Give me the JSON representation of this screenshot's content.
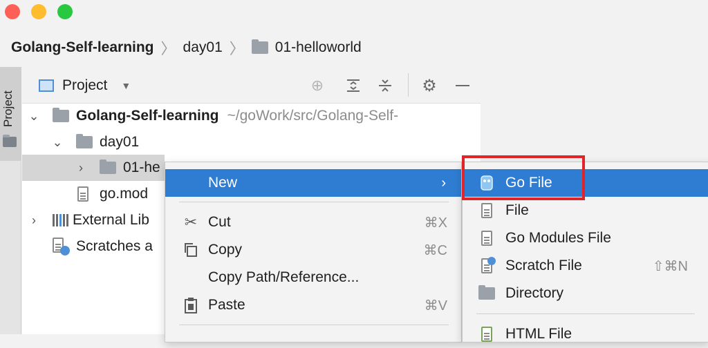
{
  "breadcrumb": {
    "project": "Golang-Self-learning",
    "dir": "day01",
    "subdir": "01-helloworld"
  },
  "side_strip": {
    "label": "Project"
  },
  "toolbar": {
    "view_label": "Project",
    "icons": [
      "locate-icon",
      "expand-all-icon",
      "collapse-all-icon",
      "gear-icon",
      "minimize-icon"
    ]
  },
  "tree": {
    "root_name": "Golang-Self-learning",
    "root_path": "~/goWork/src/Golang-Self-",
    "day01": "day01",
    "helloworld": "01-he",
    "gomod": "go.mod",
    "external": "External Lib",
    "scratches": "Scratches a"
  },
  "context_menu": {
    "new": "New",
    "cut": "Cut",
    "cut_shortcut": "⌘X",
    "copy": "Copy",
    "copy_shortcut": "⌘C",
    "copy_path": "Copy Path/Reference...",
    "paste": "Paste",
    "paste_shortcut": "⌘V"
  },
  "submenu": {
    "go_file": "Go File",
    "file": "File",
    "go_modules_file": "Go Modules File",
    "scratch_file": "Scratch File",
    "scratch_shortcut": "⇧⌘N",
    "directory": "Directory",
    "html_file": "HTML File"
  },
  "colors": {
    "selection": "#2f7dd2",
    "highlight_border": "#e0252a"
  }
}
